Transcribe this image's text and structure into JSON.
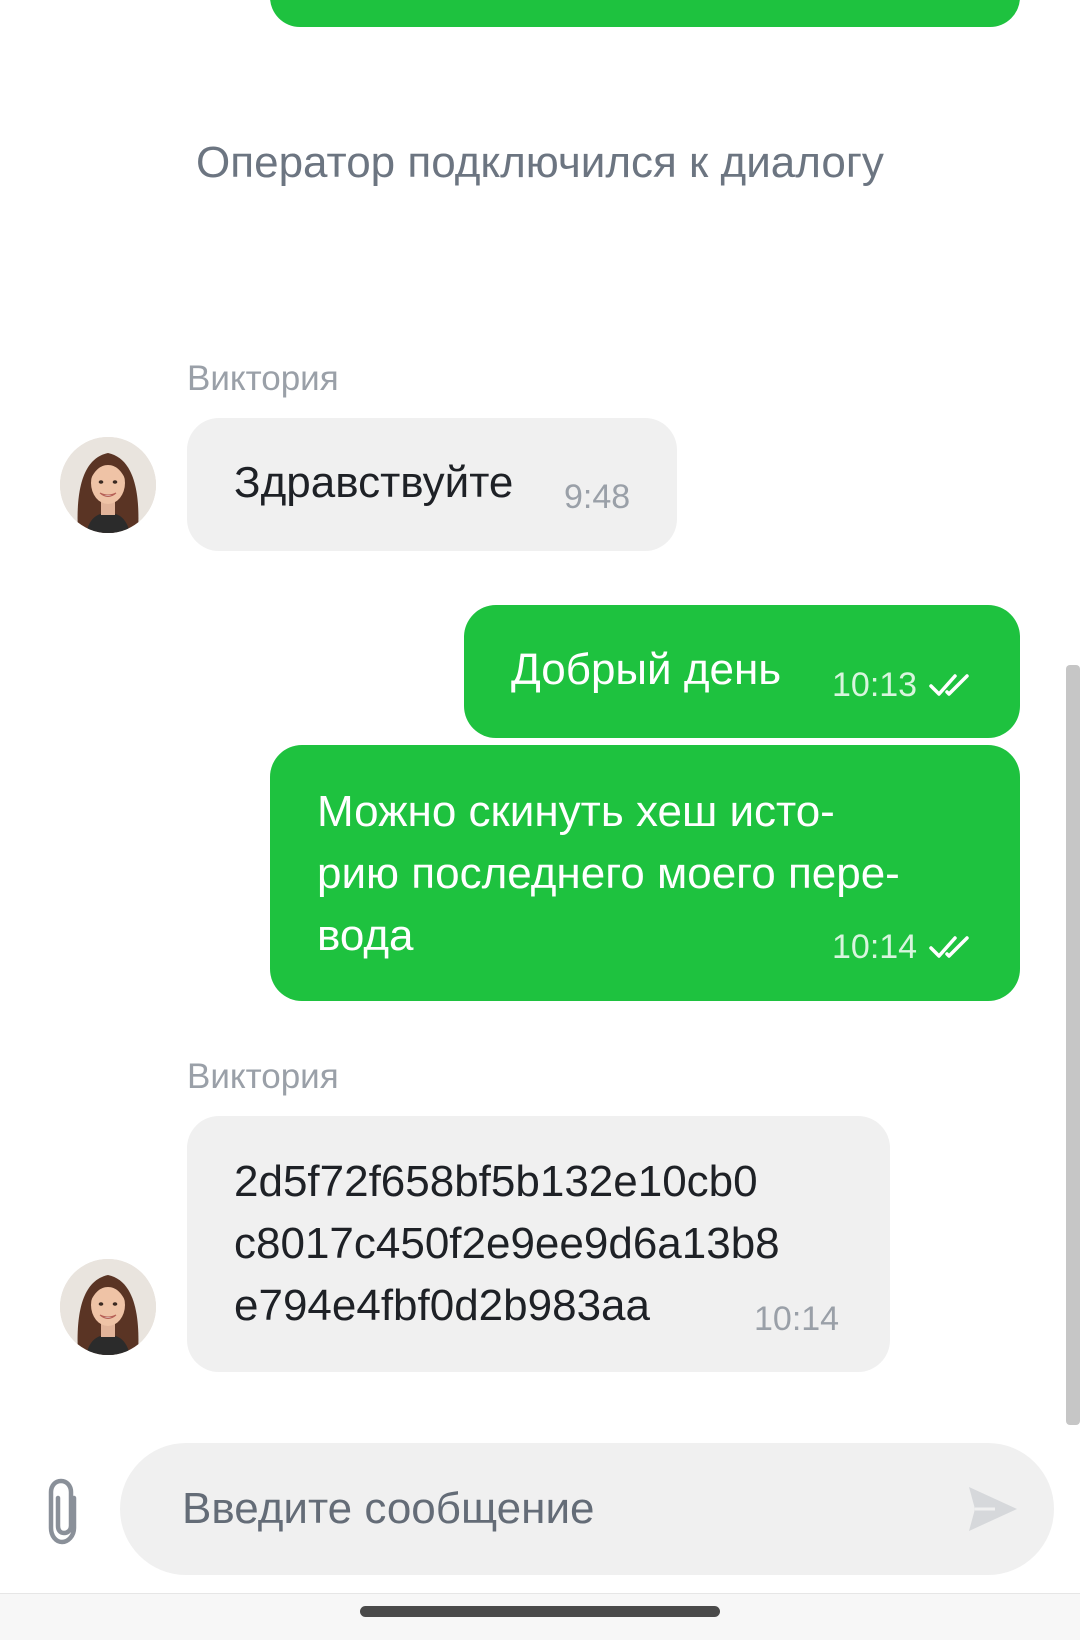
{
  "system_message": "Оператор подключился к\nдиалогу",
  "messages": [
    {
      "direction": "in",
      "sender": "Виктория",
      "text": "Здравствуйте",
      "time": "9:48"
    },
    {
      "direction": "out",
      "text": "Добрый день",
      "time": "10:13",
      "status_icon": "double-check-icon"
    },
    {
      "direction": "out",
      "text": "Можно скинуть хеш исто-\nрию последнего моего пере-\nвода",
      "time": "10:14",
      "status_icon": "double-check-icon"
    },
    {
      "direction": "in",
      "sender": "Виктория",
      "text": "2d5f72f658bf5b132e10cb0\nc8017c450f2e9ee9d6a13b8\ne794e4fbf0d2b983aa",
      "time": "10:14"
    }
  ],
  "composer": {
    "placeholder": "Введите сообщение",
    "attach_icon": "paperclip-icon",
    "send_icon": "send-icon"
  },
  "colors": {
    "outgoing_bubble": "#1ec23f",
    "incoming_bubble": "#f0f0f0",
    "system_text": "#6c7581",
    "sender_name": "#9aa0a8"
  }
}
